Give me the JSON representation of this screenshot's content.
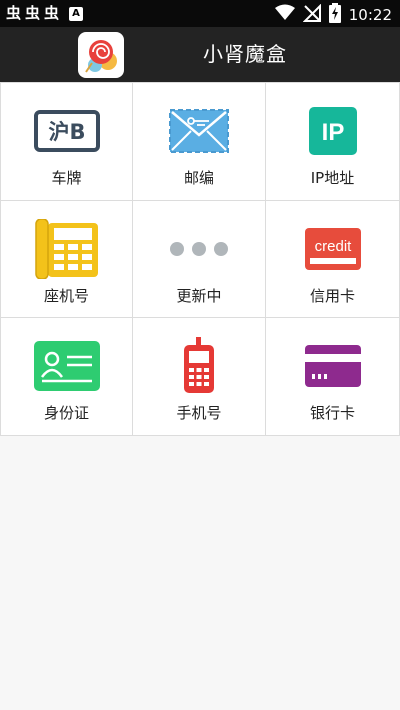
{
  "status_bar": {
    "notification_glyphs": [
      "虫",
      "虫",
      "虫"
    ],
    "a_badge": "A",
    "time": "10:22",
    "icons": [
      "wifi-icon",
      "signal-off-icon",
      "battery-charging-icon"
    ]
  },
  "app_bar": {
    "title": "小肾魔盒",
    "logo": "lollipop-logo-icon"
  },
  "grid": {
    "items": [
      {
        "label": "车牌",
        "icon": "license-plate-icon",
        "plate_text": "沪B",
        "color": "#3b4c5e"
      },
      {
        "label": "邮编",
        "icon": "envelope-icon",
        "color": "#4aa3df"
      },
      {
        "label": "IP地址",
        "icon": "ip-icon",
        "ip_text": "IP",
        "color": "#16b79a"
      },
      {
        "label": "座机号",
        "icon": "desk-phone-icon",
        "color": "#f3c21a"
      },
      {
        "label": "更新中",
        "icon": "more-dots-icon",
        "color": "#b0b6ba"
      },
      {
        "label": "信用卡",
        "icon": "credit-card-icon",
        "card_text": "credit",
        "color": "#e74c3c"
      },
      {
        "label": "身份证",
        "icon": "id-card-icon",
        "color": "#2ecc71"
      },
      {
        "label": "手机号",
        "icon": "mobile-phone-icon",
        "color": "#e53935"
      },
      {
        "label": "银行卡",
        "icon": "bank-card-icon",
        "color": "#8e2a8e"
      }
    ]
  }
}
